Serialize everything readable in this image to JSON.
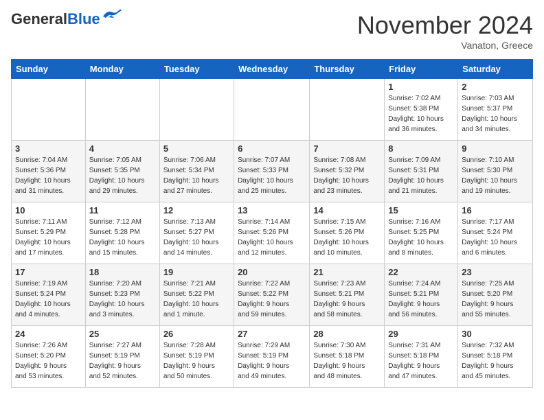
{
  "logo": {
    "line1": "General",
    "line2": "Blue"
  },
  "title": "November 2024",
  "location": "Vanaton, Greece",
  "weekdays": [
    "Sunday",
    "Monday",
    "Tuesday",
    "Wednesday",
    "Thursday",
    "Friday",
    "Saturday"
  ],
  "weeks": [
    [
      {
        "day": "",
        "info": ""
      },
      {
        "day": "",
        "info": ""
      },
      {
        "day": "",
        "info": ""
      },
      {
        "day": "",
        "info": ""
      },
      {
        "day": "",
        "info": ""
      },
      {
        "day": "1",
        "info": "Sunrise: 7:02 AM\nSunset: 5:38 PM\nDaylight: 10 hours\nand 36 minutes."
      },
      {
        "day": "2",
        "info": "Sunrise: 7:03 AM\nSunset: 5:37 PM\nDaylight: 10 hours\nand 34 minutes."
      }
    ],
    [
      {
        "day": "3",
        "info": "Sunrise: 7:04 AM\nSunset: 5:36 PM\nDaylight: 10 hours\nand 31 minutes."
      },
      {
        "day": "4",
        "info": "Sunrise: 7:05 AM\nSunset: 5:35 PM\nDaylight: 10 hours\nand 29 minutes."
      },
      {
        "day": "5",
        "info": "Sunrise: 7:06 AM\nSunset: 5:34 PM\nDaylight: 10 hours\nand 27 minutes."
      },
      {
        "day": "6",
        "info": "Sunrise: 7:07 AM\nSunset: 5:33 PM\nDaylight: 10 hours\nand 25 minutes."
      },
      {
        "day": "7",
        "info": "Sunrise: 7:08 AM\nSunset: 5:32 PM\nDaylight: 10 hours\nand 23 minutes."
      },
      {
        "day": "8",
        "info": "Sunrise: 7:09 AM\nSunset: 5:31 PM\nDaylight: 10 hours\nand 21 minutes."
      },
      {
        "day": "9",
        "info": "Sunrise: 7:10 AM\nSunset: 5:30 PM\nDaylight: 10 hours\nand 19 minutes."
      }
    ],
    [
      {
        "day": "10",
        "info": "Sunrise: 7:11 AM\nSunset: 5:29 PM\nDaylight: 10 hours\nand 17 minutes."
      },
      {
        "day": "11",
        "info": "Sunrise: 7:12 AM\nSunset: 5:28 PM\nDaylight: 10 hours\nand 15 minutes."
      },
      {
        "day": "12",
        "info": "Sunrise: 7:13 AM\nSunset: 5:27 PM\nDaylight: 10 hours\nand 14 minutes."
      },
      {
        "day": "13",
        "info": "Sunrise: 7:14 AM\nSunset: 5:26 PM\nDaylight: 10 hours\nand 12 minutes."
      },
      {
        "day": "14",
        "info": "Sunrise: 7:15 AM\nSunset: 5:26 PM\nDaylight: 10 hours\nand 10 minutes."
      },
      {
        "day": "15",
        "info": "Sunrise: 7:16 AM\nSunset: 5:25 PM\nDaylight: 10 hours\nand 8 minutes."
      },
      {
        "day": "16",
        "info": "Sunrise: 7:17 AM\nSunset: 5:24 PM\nDaylight: 10 hours\nand 6 minutes."
      }
    ],
    [
      {
        "day": "17",
        "info": "Sunrise: 7:19 AM\nSunset: 5:24 PM\nDaylight: 10 hours\nand 4 minutes."
      },
      {
        "day": "18",
        "info": "Sunrise: 7:20 AM\nSunset: 5:23 PM\nDaylight: 10 hours\nand 3 minutes."
      },
      {
        "day": "19",
        "info": "Sunrise: 7:21 AM\nSunset: 5:22 PM\nDaylight: 10 hours\nand 1 minute."
      },
      {
        "day": "20",
        "info": "Sunrise: 7:22 AM\nSunset: 5:22 PM\nDaylight: 9 hours\nand 59 minutes."
      },
      {
        "day": "21",
        "info": "Sunrise: 7:23 AM\nSunset: 5:21 PM\nDaylight: 9 hours\nand 58 minutes."
      },
      {
        "day": "22",
        "info": "Sunrise: 7:24 AM\nSunset: 5:21 PM\nDaylight: 9 hours\nand 56 minutes."
      },
      {
        "day": "23",
        "info": "Sunrise: 7:25 AM\nSunset: 5:20 PM\nDaylight: 9 hours\nand 55 minutes."
      }
    ],
    [
      {
        "day": "24",
        "info": "Sunrise: 7:26 AM\nSunset: 5:20 PM\nDaylight: 9 hours\nand 53 minutes."
      },
      {
        "day": "25",
        "info": "Sunrise: 7:27 AM\nSunset: 5:19 PM\nDaylight: 9 hours\nand 52 minutes."
      },
      {
        "day": "26",
        "info": "Sunrise: 7:28 AM\nSunset: 5:19 PM\nDaylight: 9 hours\nand 50 minutes."
      },
      {
        "day": "27",
        "info": "Sunrise: 7:29 AM\nSunset: 5:19 PM\nDaylight: 9 hours\nand 49 minutes."
      },
      {
        "day": "28",
        "info": "Sunrise: 7:30 AM\nSunset: 5:18 PM\nDaylight: 9 hours\nand 48 minutes."
      },
      {
        "day": "29",
        "info": "Sunrise: 7:31 AM\nSunset: 5:18 PM\nDaylight: 9 hours\nand 47 minutes."
      },
      {
        "day": "30",
        "info": "Sunrise: 7:32 AM\nSunset: 5:18 PM\nDaylight: 9 hours\nand 45 minutes."
      }
    ]
  ]
}
